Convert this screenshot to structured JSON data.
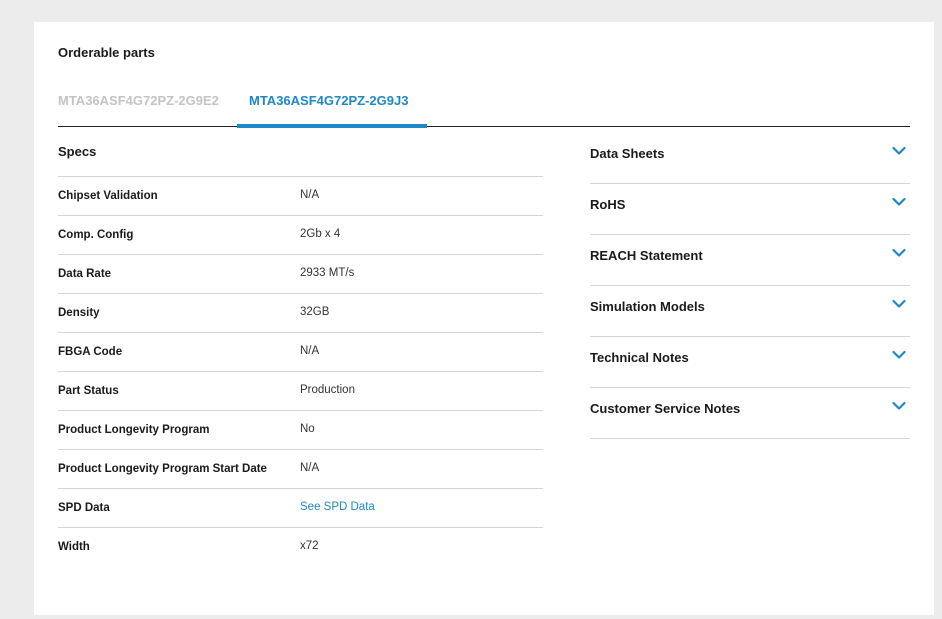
{
  "section": {
    "title": "Orderable parts"
  },
  "tabs": [
    {
      "label": "MTA36ASF4G72PZ-2G9E2",
      "active": false
    },
    {
      "label": "MTA36ASF4G72PZ-2G9J3",
      "active": true
    }
  ],
  "specs": {
    "title": "Specs",
    "rows": [
      {
        "label": "Chipset Validation",
        "value": "N/A"
      },
      {
        "label": "Comp. Config",
        "value": "2Gb x 4"
      },
      {
        "label": "Data Rate",
        "value": "2933 MT/s"
      },
      {
        "label": "Density",
        "value": "32GB"
      },
      {
        "label": "FBGA Code",
        "value": "N/A"
      },
      {
        "label": "Part Status",
        "value": "Production"
      },
      {
        "label": "Product Longevity Program",
        "value": "No"
      },
      {
        "label": "Product Longevity Program Start Date",
        "value": "N/A"
      },
      {
        "label": "SPD Data",
        "value": "See SPD Data"
      },
      {
        "label": "Width",
        "value": "x72"
      }
    ]
  },
  "documents": [
    {
      "label": "Data Sheets",
      "icon": "chevron-down-icon"
    },
    {
      "label": "RoHS",
      "icon": "chevron-down-icon"
    },
    {
      "label": "REACH Statement",
      "icon": "chevron-down-icon"
    },
    {
      "label": "Simulation Models",
      "icon": "chevron-down-icon"
    },
    {
      "label": "Technical Notes",
      "icon": "chevron-down-icon"
    },
    {
      "label": "Customer Service Notes",
      "icon": "chevron-down-icon"
    }
  ],
  "colors": {
    "accent": "#1e88c7",
    "inactive_tab": "#c4c4c4",
    "page_bg": "#ececec"
  }
}
